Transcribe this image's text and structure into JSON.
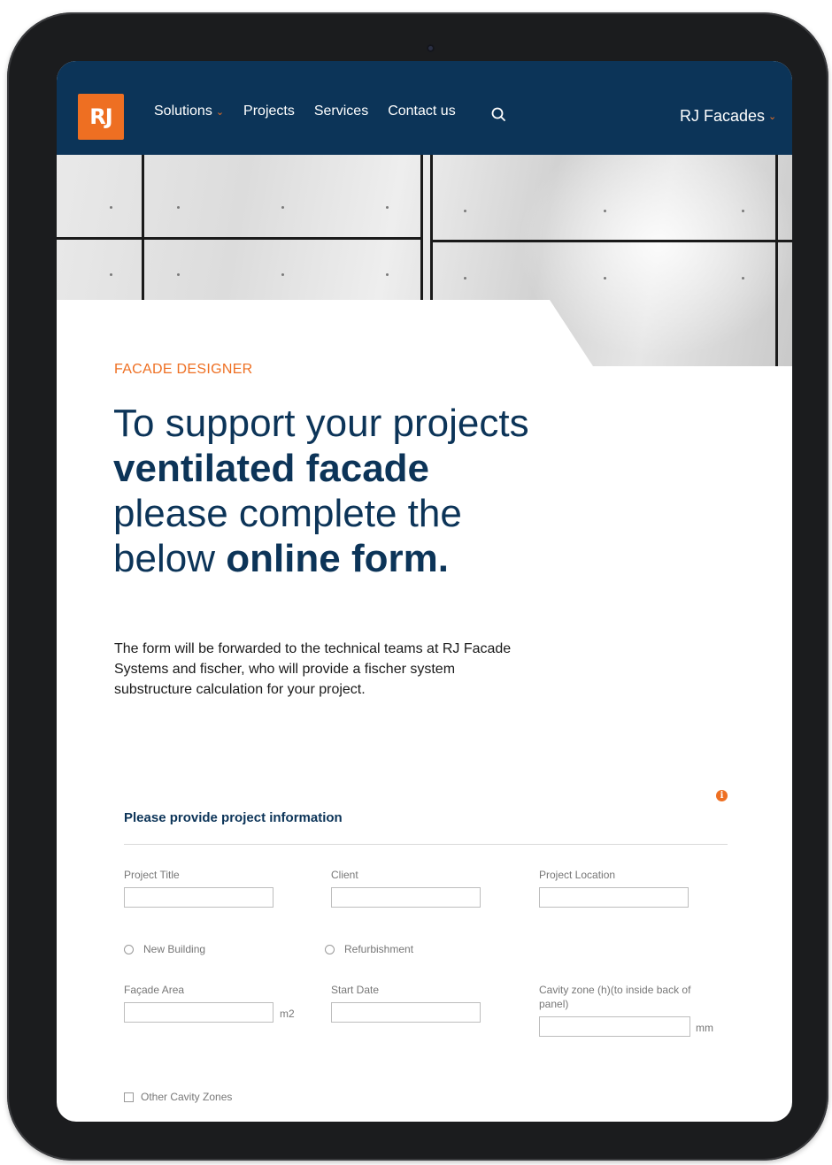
{
  "nav": {
    "logo": "RJ",
    "items": [
      {
        "label": "Solutions",
        "has_dropdown": true
      },
      {
        "label": "Projects",
        "has_dropdown": false
      },
      {
        "label": "Services",
        "has_dropdown": false
      },
      {
        "label": "Contact us",
        "has_dropdown": false
      }
    ],
    "search_icon": "search-icon",
    "brand_menu": "RJ Facades"
  },
  "hero": {
    "eyebrow": "FACADE DESIGNER",
    "headline": [
      {
        "text": "To support your projects ",
        "bold": false
      },
      {
        "text": "ventilated facade",
        "bold": true
      },
      {
        "text": " please complete the below ",
        "bold": false
      },
      {
        "text": "online form.",
        "bold": true
      }
    ],
    "intro": "The form will be forwarded to the technical teams at RJ Facade Systems and fischer, who will provide a fischer system substructure calculation for your project."
  },
  "form": {
    "title": "Please provide project information",
    "fields": {
      "project_title": {
        "label": "Project Title",
        "value": ""
      },
      "client": {
        "label": "Client",
        "value": ""
      },
      "project_location": {
        "label": "Project Location",
        "value": ""
      },
      "facade_area": {
        "label": "Façade Area",
        "value": "",
        "unit": "m2"
      },
      "start_date": {
        "label": "Start Date",
        "value": ""
      },
      "cavity_zone": {
        "label": "Cavity zone (h)(to inside back of panel)",
        "value": "",
        "unit": "mm"
      }
    },
    "building_type": {
      "options": [
        "New Building",
        "Refurbishment"
      ],
      "selected": null
    },
    "other_cavity_zones": {
      "label": "Other Cavity Zones",
      "checked": false
    }
  },
  "colors": {
    "navy": "#0c3458",
    "accent": "#ee6f22"
  }
}
